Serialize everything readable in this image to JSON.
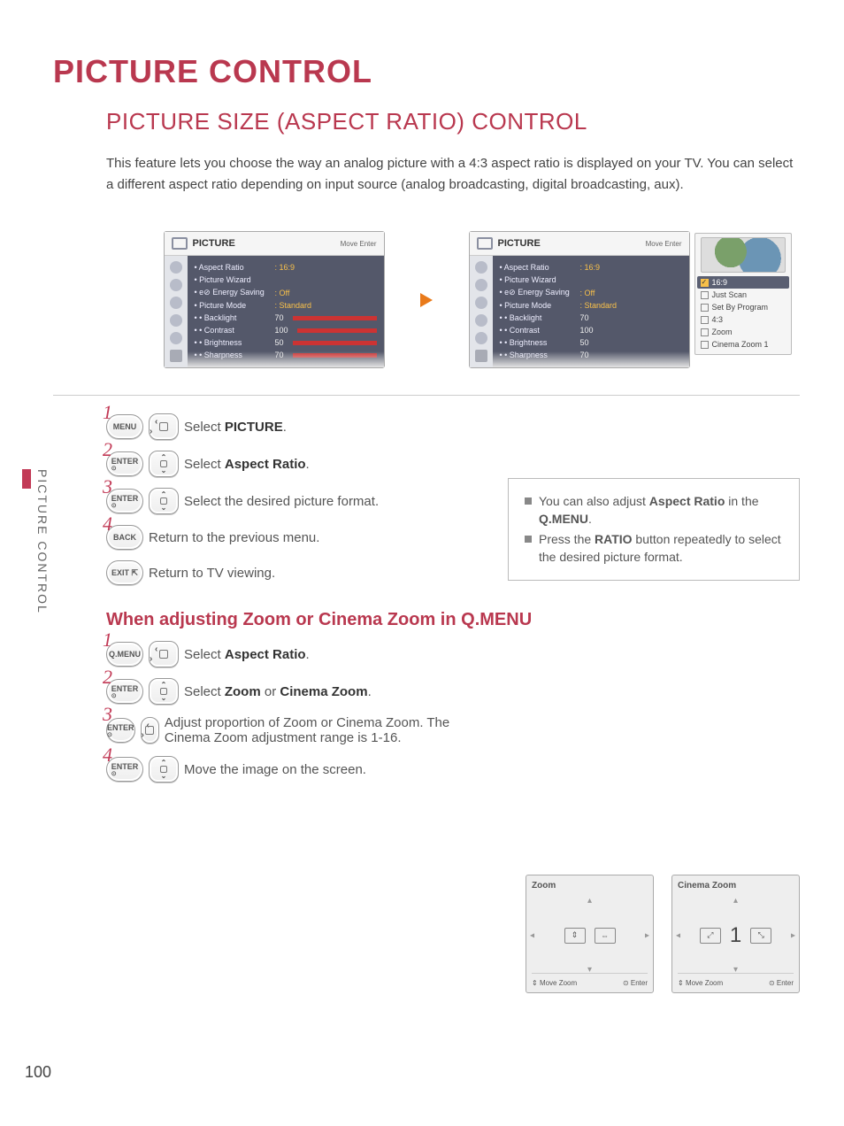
{
  "page_number": "100",
  "side_label": "PICTURE CONTROL",
  "title": "PICTURE CONTROL",
  "subtitle": "PICTURE SIZE (ASPECT RATIO) CONTROL",
  "intro": "This feature lets you choose the way an analog picture with a 4:3 aspect ratio is displayed on your TV. You can select a different aspect ratio depending on input source (analog broadcasting, digital broadcasting, aux).",
  "osd": {
    "header_label": "PICTURE",
    "header_hint": "Move    Enter",
    "items": [
      {
        "label": "Aspect Ratio",
        "value": ": 16:9",
        "hl": true
      },
      {
        "label": "Picture Wizard",
        "value": ""
      },
      {
        "label": "e⊘ Energy Saving",
        "value": ": Off"
      },
      {
        "label": "Picture Mode",
        "value": ": Standard"
      },
      {
        "label": "• Backlight",
        "value": "70",
        "bar": true
      },
      {
        "label": "• Contrast",
        "value": "100",
        "bar": true
      },
      {
        "label": "• Brightness",
        "value": "50",
        "bar": true
      },
      {
        "label": "• Sharpness",
        "value": "70",
        "bar": true
      }
    ],
    "popup": [
      {
        "label": "16:9",
        "selected": true
      },
      {
        "label": "Just Scan"
      },
      {
        "label": "Set By Program"
      },
      {
        "label": "4:3"
      },
      {
        "label": "Zoom"
      },
      {
        "label": "Cinema Zoom 1"
      }
    ]
  },
  "steps": [
    {
      "num": "1",
      "btn": "MENU",
      "nav": "lr",
      "text_a": "Select ",
      "text_b": "PICTURE",
      "text_c": "."
    },
    {
      "num": "2",
      "btn": "ENTER",
      "btn_sub": "⊙",
      "nav": "ud",
      "text_a": "Select ",
      "text_b": "Aspect Ratio",
      "text_c": "."
    },
    {
      "num": "3",
      "btn": "ENTER",
      "btn_sub": "⊙",
      "nav": "ud",
      "text_a": "Select the desired picture format."
    },
    {
      "num": "4",
      "btn": "BACK",
      "text_a": "Return to the previous menu."
    },
    {
      "btn": "EXIT ⇱",
      "text_a": "Return to TV viewing."
    }
  ],
  "tips": {
    "t1a": "You can also adjust ",
    "t1b": "Aspect Ratio",
    "t1c": " in the ",
    "t1d": "Q.MENU",
    "t1e": ".",
    "t2a": "Press the ",
    "t2b": "RATIO",
    "t2c": " button repeatedly to select the desired picture format."
  },
  "sub_heading_parts": {
    "a": "When adjusting ",
    "b": "Zoom",
    "c": " or ",
    "d": "Cinema Zoom",
    "e": " in Q.MENU"
  },
  "steps2": [
    {
      "num": "1",
      "btn": "Q.MENU",
      "nav": "lr",
      "text_a": "Select ",
      "text_b": "Aspect Ratio",
      "text_c": "."
    },
    {
      "num": "2",
      "btn": "ENTER",
      "btn_sub": "⊙",
      "nav": "ud",
      "text_a": "Select ",
      "text_b": "Zoom",
      "text_c": " or ",
      "text_d": "Cinema Zoom",
      "text_e": "."
    },
    {
      "num": "3",
      "btn": "ENTER",
      "btn_sub": "⊙",
      "nav": "lr",
      "text_a": "Adjust proportion of Zoom or Cinema Zoom. The Cinema Zoom adjustment range is 1-16."
    },
    {
      "num": "4",
      "btn": "ENTER",
      "btn_sub": "⊙",
      "nav": "ud",
      "text_a": "Move the image on the screen."
    }
  ],
  "zoom_panels": {
    "left": {
      "title": "Zoom",
      "foot_l": "Move   Zoom",
      "foot_r": "Enter"
    },
    "right": {
      "title": "Cinema Zoom",
      "center": "1",
      "foot_l": "Move   Zoom",
      "foot_r": "Enter"
    }
  }
}
